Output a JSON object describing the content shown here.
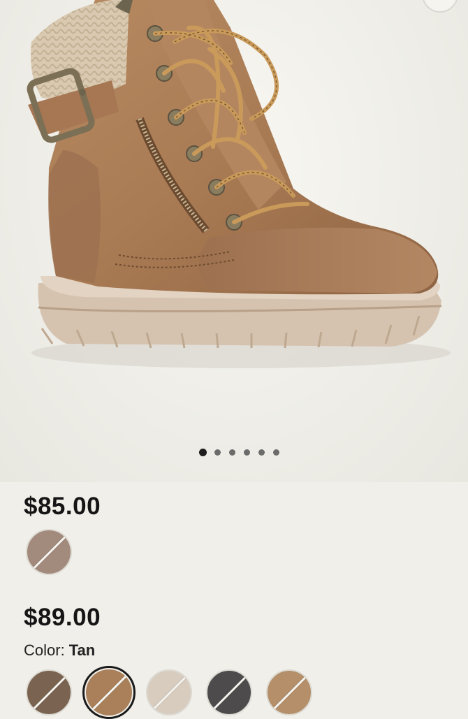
{
  "carousel": {
    "total_slides": 6,
    "active_slide": 1
  },
  "offers": [
    {
      "price": "$85.00",
      "swatches": [
        {
          "name": "taupe",
          "fill": "#a28a7c",
          "selected": false
        }
      ]
    },
    {
      "price": "$89.00",
      "color_label": "Color:",
      "color_value": "Tan",
      "swatches": [
        {
          "name": "dark-brown",
          "fill": "#7a6350",
          "selected": false
        },
        {
          "name": "tan",
          "fill": "#a9805a",
          "selected": true
        },
        {
          "name": "cream",
          "fill": "#d8ccbf",
          "selected": false
        },
        {
          "name": "charcoal",
          "fill": "#4d4b4b",
          "selected": false
        },
        {
          "name": "camel",
          "fill": "#b48f6a",
          "selected": false
        }
      ]
    }
  ],
  "colors": {
    "background": "#f0efe9",
    "boot_leather": "#a97b54",
    "sole": "#d5c3b0",
    "dot_active": "#1e1e1e",
    "dot_inactive": "#6b6b6b"
  }
}
